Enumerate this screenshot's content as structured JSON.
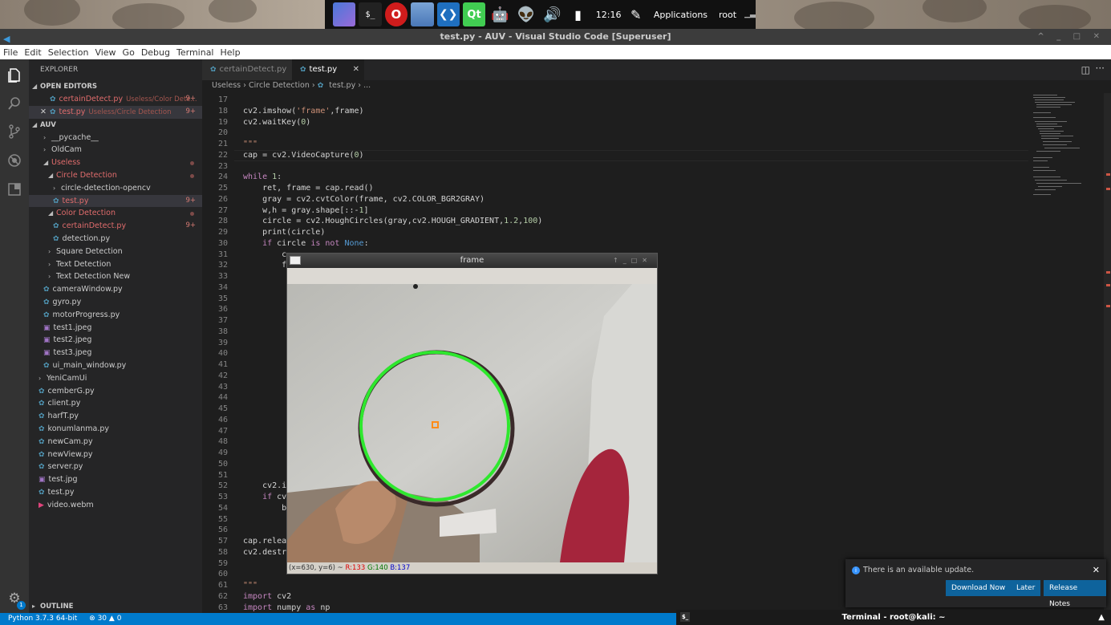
{
  "panel": {
    "time": "12:16",
    "applications": "Applications",
    "user": "root",
    "dock_icons": [
      "window-manager-icon",
      "terminal-icon",
      "opera-icon",
      "files-icon",
      "vscode-icon",
      "qt-icon",
      "android-icon",
      "alien-icon",
      "volume-icon",
      "battery-icon"
    ]
  },
  "window": {
    "title": "test.py - AUV - Visual Studio Code [Superuser]"
  },
  "menu": [
    "File",
    "Edit",
    "Selection",
    "View",
    "Go",
    "Debug",
    "Terminal",
    "Help"
  ],
  "explorer": {
    "title": "EXPLORER",
    "open_editors": "OPEN EDITORS",
    "open_files": [
      {
        "name": "certainDetect.py",
        "desc": "Useless/Color Dete...",
        "badge": "9+"
      },
      {
        "name": "test.py",
        "desc": "Useless/Circle Detection",
        "badge": "9+"
      }
    ],
    "root": "AUV",
    "tree": [
      {
        "label": "__pycache__",
        "type": "folder"
      },
      {
        "label": "OldCam",
        "type": "folder"
      },
      {
        "label": "Useless",
        "type": "folder-open"
      },
      {
        "label": "Circle Detection",
        "type": "folder-open"
      },
      {
        "label": "circle-detection-opencv",
        "type": "folder"
      },
      {
        "label": "test.py",
        "type": "py",
        "badge": "9+"
      },
      {
        "label": "Color Detection",
        "type": "folder-open"
      },
      {
        "label": "certainDetect.py",
        "type": "py",
        "badge": "9+"
      },
      {
        "label": "detection.py",
        "type": "py"
      },
      {
        "label": "Square Detection",
        "type": "folder"
      },
      {
        "label": "Text Detection",
        "type": "folder"
      },
      {
        "label": "Text Detection New",
        "type": "folder"
      },
      {
        "label": "cameraWindow.py",
        "type": "py"
      },
      {
        "label": "gyro.py",
        "type": "py"
      },
      {
        "label": "motorProgress.py",
        "type": "py"
      },
      {
        "label": "test1.jpeg",
        "type": "img"
      },
      {
        "label": "test2.jpeg",
        "type": "img"
      },
      {
        "label": "test3.jpeg",
        "type": "img"
      },
      {
        "label": "ui_main_window.py",
        "type": "py"
      },
      {
        "label": "YeniCamUi",
        "type": "folder"
      },
      {
        "label": "cemberG.py",
        "type": "py"
      },
      {
        "label": "client.py",
        "type": "py"
      },
      {
        "label": "harfT.py",
        "type": "py"
      },
      {
        "label": "konumlanma.py",
        "type": "py"
      },
      {
        "label": "newCam.py",
        "type": "py"
      },
      {
        "label": "newView.py",
        "type": "py"
      },
      {
        "label": "server.py",
        "type": "py"
      },
      {
        "label": "test.jpg",
        "type": "img"
      },
      {
        "label": "test.py",
        "type": "py"
      },
      {
        "label": "video.webm",
        "type": "video"
      }
    ],
    "outline": "OUTLINE",
    "gear_badge": "1"
  },
  "tabs": [
    {
      "label": "certainDetect.py",
      "active": false
    },
    {
      "label": "test.py",
      "active": true
    }
  ],
  "breadcrumb": [
    "Useless",
    "Circle Detection",
    "test.py",
    "..."
  ],
  "code": [
    {
      "n": "17",
      "t": ""
    },
    {
      "n": "18",
      "t": "cv2.imshow('frame',frame)"
    },
    {
      "n": "19",
      "t": "cv2.waitKey(0)"
    },
    {
      "n": "20",
      "t": ""
    },
    {
      "n": "21",
      "t": "\"\"\""
    },
    {
      "n": "22",
      "t": "cap = cv2.VideoCapture(0)"
    },
    {
      "n": "23",
      "t": ""
    },
    {
      "n": "24",
      "t": "while 1:"
    },
    {
      "n": "25",
      "t": "    ret, frame = cap.read()"
    },
    {
      "n": "26",
      "t": "    gray = cv2.cvtColor(frame, cv2.COLOR_BGR2GRAY)"
    },
    {
      "n": "27",
      "t": "    w,h = gray.shape[::-1]"
    },
    {
      "n": "28",
      "t": "    circle = cv2.HoughCircles(gray,cv2.HOUGH_GRADIENT,1.2,100)"
    },
    {
      "n": "29",
      "t": "    print(circle)"
    },
    {
      "n": "30",
      "t": "    if circle is not None:"
    },
    {
      "n": "31",
      "t": "        c"
    },
    {
      "n": "32",
      "t": "        f"
    },
    {
      "n": "33",
      "t": ""
    },
    {
      "n": "34",
      "t": ""
    },
    {
      "n": "35",
      "t": ""
    },
    {
      "n": "36",
      "t": ""
    },
    {
      "n": "37",
      "t": ""
    },
    {
      "n": "38",
      "t": ""
    },
    {
      "n": "39",
      "t": ""
    },
    {
      "n": "40",
      "t": ""
    },
    {
      "n": "41",
      "t": ""
    },
    {
      "n": "42",
      "t": ""
    },
    {
      "n": "43",
      "t": ""
    },
    {
      "n": "44",
      "t": ""
    },
    {
      "n": "45",
      "t": ""
    },
    {
      "n": "46",
      "t": ""
    },
    {
      "n": "47",
      "t": ""
    },
    {
      "n": "48",
      "t": ""
    },
    {
      "n": "49",
      "t": ""
    },
    {
      "n": "50",
      "t": ""
    },
    {
      "n": "51",
      "t": ""
    },
    {
      "n": "52",
      "t": "    cv2.i"
    },
    {
      "n": "53",
      "t": "    if cv"
    },
    {
      "n": "54",
      "t": "        b"
    },
    {
      "n": "55",
      "t": ""
    },
    {
      "n": "56",
      "t": ""
    },
    {
      "n": "57",
      "t": "cap.relea"
    },
    {
      "n": "58",
      "t": "cv2.destr"
    },
    {
      "n": "59",
      "t": ""
    },
    {
      "n": "60",
      "t": ""
    },
    {
      "n": "61",
      "t": "\"\"\""
    },
    {
      "n": "62",
      "t": "import cv2"
    },
    {
      "n": "63",
      "t": "import numpy as np"
    }
  ],
  "frame_window": {
    "title": "frame",
    "status": "(x=630, y=6) ~",
    "r": "R:133",
    "g": "G:140",
    "b": "B:137"
  },
  "notification": {
    "message": "There is an available update.",
    "btn_download": "Download Now",
    "btn_later": "Later",
    "btn_notes": "Release Notes"
  },
  "statusbar": {
    "python": "Python 3.7.3 64-bit",
    "errors": "30",
    "warnings": "0"
  },
  "terminal": {
    "title": "Terminal - root@kali: ~"
  },
  "colors": {
    "accent": "#007acc",
    "button": "#0e639c",
    "error": "#e06c6c",
    "circle": "#2ee82e"
  }
}
